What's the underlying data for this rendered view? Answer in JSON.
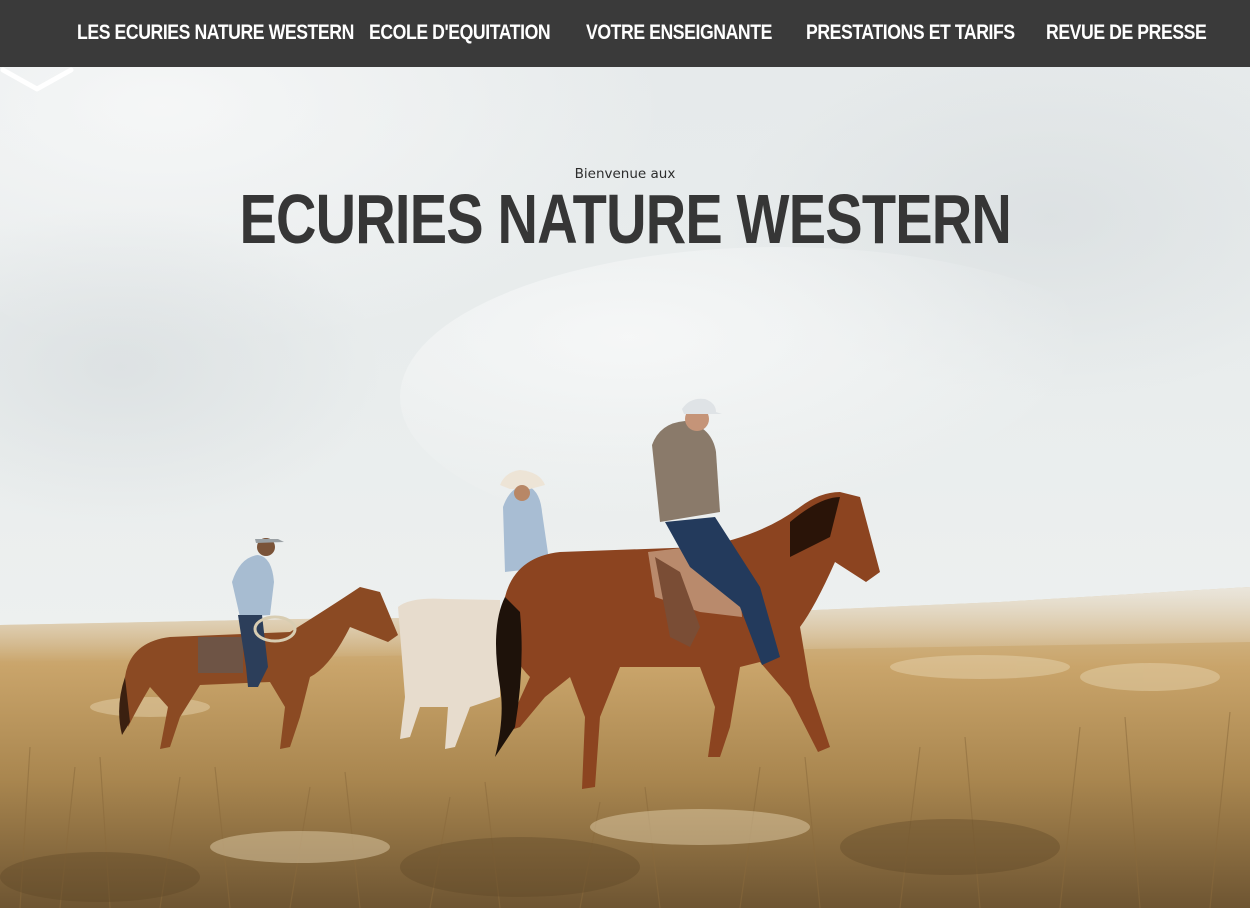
{
  "nav": {
    "items": [
      {
        "label": "LES ECURIES NATURE WESTERN"
      },
      {
        "label": "ECOLE D'EQUITATION"
      },
      {
        "label": "VOTRE ENSEIGNANTE"
      },
      {
        "label": "PRESTATIONS ET TARIFS"
      },
      {
        "label": "REVUE DE PRESSE"
      }
    ]
  },
  "hero": {
    "eyebrow": "Bienvenue aux",
    "title": "ECURIES NATURE WESTERN",
    "scroll_icon": "chevron-down-icon"
  },
  "colors": {
    "nav_bg": "#3a3a3a",
    "nav_text": "#ffffff",
    "title_text": "#363636"
  }
}
